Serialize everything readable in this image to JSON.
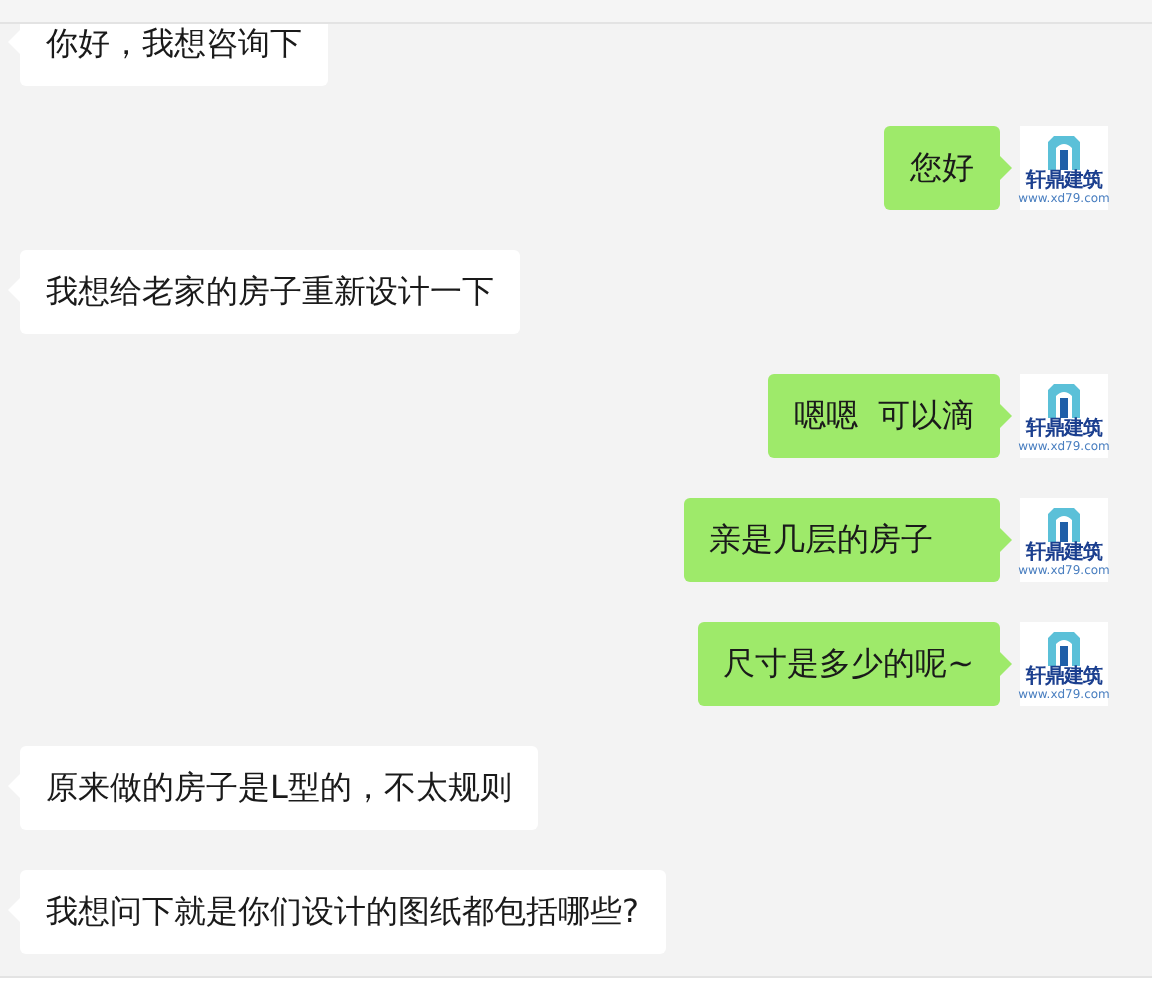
{
  "messages": [
    {
      "kind": "incoming",
      "text": "你好，我想咨询下"
    },
    {
      "kind": "outgoing",
      "text": "您好",
      "avatar": {
        "title": "轩鼎建筑",
        "url": "www.xd79.com"
      }
    },
    {
      "kind": "incoming",
      "text": "我想给老家的房子重新设计一下"
    },
    {
      "kind": "outgoing",
      "text": "嗯嗯  可以滴",
      "avatar": {
        "title": "轩鼎建筑",
        "url": "www.xd79.com"
      }
    },
    {
      "kind": "outgoing",
      "text": "亲是几层的房子    ",
      "avatar": {
        "title": "轩鼎建筑",
        "url": "www.xd79.com"
      }
    },
    {
      "kind": "outgoing",
      "text": "尺寸是多少的呢~",
      "avatar": {
        "title": "轩鼎建筑",
        "url": "www.xd79.com"
      }
    },
    {
      "kind": "incoming",
      "text": "原来做的房子是L型的，不太规则"
    },
    {
      "kind": "incoming",
      "text": "我想问下就是你们设计的图纸都包括哪些?"
    }
  ]
}
